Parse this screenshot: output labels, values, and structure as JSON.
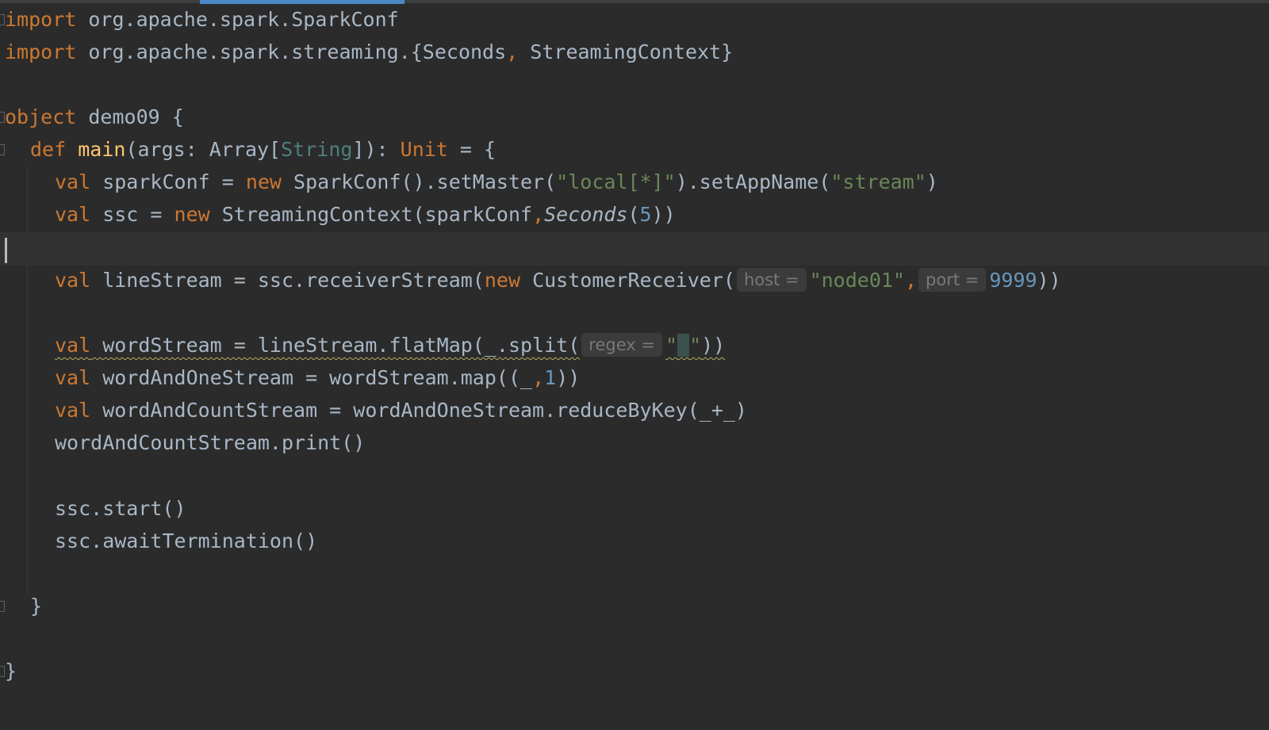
{
  "code": {
    "l1": {
      "kw": "import",
      "rest": " org.apache.spark.SparkConf"
    },
    "l2": {
      "kw": "import",
      "a": " org.apache.spark.streaming.{Seconds",
      "comma": ",",
      "b": " StreamingContext}"
    },
    "l4": {
      "kw": "object",
      "rest": " demo09 {"
    },
    "l5": {
      "kw": "def",
      "sp": " ",
      "fn": "main",
      "a": "(args: Array[",
      "tp": "String",
      "b": "]): ",
      "unit": "Unit",
      "c": " = {"
    },
    "l6": {
      "kw": "val",
      "a": " sparkConf = ",
      "new": "new",
      "b": " SparkConf().setMaster(",
      "s1": "\"local[*]\"",
      "c": ").setAppName(",
      "s2": "\"stream\"",
      "d": ")"
    },
    "l7": {
      "kw": "val",
      "a": " ssc = ",
      "new": "new",
      "b": " StreamingContext(sparkConf",
      "comma": ",",
      "it": "Seconds",
      "c": "(",
      "num": "5",
      "d": "))"
    },
    "l9": {
      "kw": "val",
      "a": " lineStream = ssc.receiverStream(",
      "new": "new",
      "b": " CustomerReceiver(",
      "hint1": "host =",
      "s1": "\"node01\"",
      "comma": ",",
      "hint2": "port =",
      "num": "9999",
      "c": "))"
    },
    "l11": {
      "kw": "val",
      "a": " wordStream = lineStream.flatMap(_.split(",
      "hint": "regex =",
      "q1": "\"",
      "sp": " ",
      "q2": "\"",
      "c": "))"
    },
    "l12": {
      "kw": "val",
      "a": " wordAndOneStream = wordStream.map((_",
      "comma": ",",
      "num": "1",
      "b": "))"
    },
    "l13": {
      "kw": "val",
      "a": " wordAndCountStream = wordAndOneStream.reduceByKey(_+_)"
    },
    "l14": {
      "a": "wordAndCountStream.print()"
    },
    "l16": {
      "a": "ssc.start()"
    },
    "l17": {
      "a": "ssc.awaitTermination()"
    },
    "l19": {
      "a": "}"
    },
    "l21": {
      "a": "}"
    }
  },
  "colors": {
    "background": "#2b2b2b",
    "keyword": "#cc7832",
    "function": "#ffc66d",
    "string": "#6a8759",
    "number": "#6897bb",
    "text": "#a9b7c6",
    "tab_accent": "#4a88c7"
  }
}
